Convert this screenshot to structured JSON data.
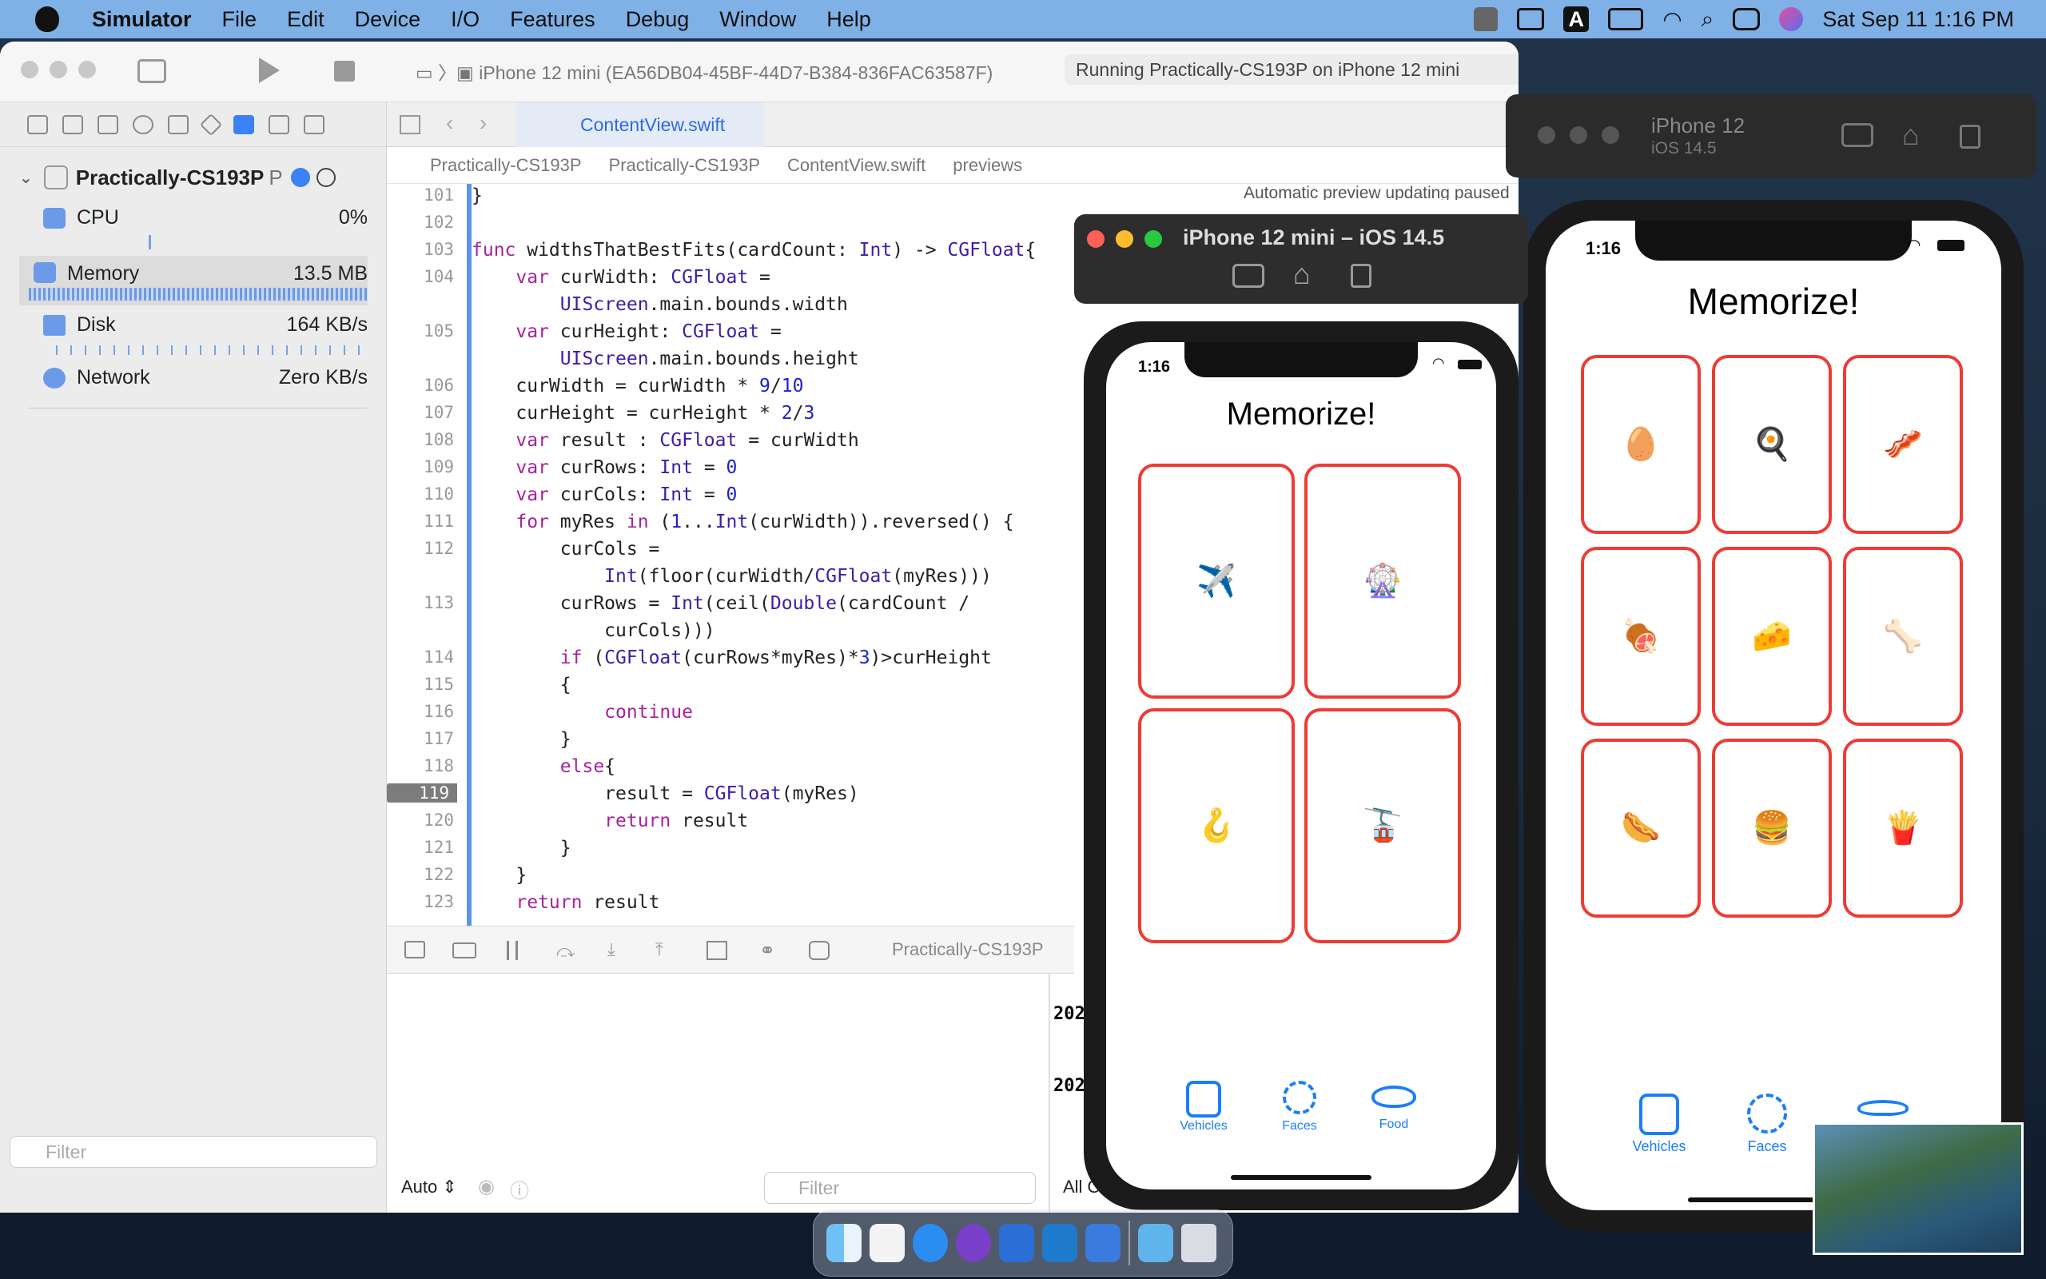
{
  "menubar": {
    "app": "Simulator",
    "items": [
      "File",
      "Edit",
      "Device",
      "I/O",
      "Features",
      "Debug",
      "Window",
      "Help"
    ],
    "clock": "Sat Sep 11  1:16 PM",
    "input_source": "A"
  },
  "xcode": {
    "scheme_device": "iPhone 12 mini (EA56DB04-45BF-44D7-B384-836FAC63587F)",
    "status": "Running Practically-CS193P on iPhone 12 mini",
    "tab": "ContentView.swift",
    "breadcrumb": [
      "Practically-CS193P",
      "Practically-CS193P",
      "ContentView.swift",
      "previews"
    ],
    "project": "Practically-CS193P",
    "project_suffix": "P",
    "gauges": [
      {
        "label": "CPU",
        "value": "0%"
      },
      {
        "label": "Memory",
        "value": "13.5 MB"
      },
      {
        "label": "Disk",
        "value": "164 KB/s"
      },
      {
        "label": "Network",
        "value": "Zero KB/s"
      }
    ],
    "nav_filter_placeholder": "Filter",
    "console_filter_placeholder": "Filter",
    "auto_label": "Auto",
    "all_output": "All Ou",
    "debug_target": "Practically-CS193P",
    "preview_notice": "Automatic preview updating paused",
    "console_lines": [
      "202",
      "202"
    ],
    "current_line": "119",
    "code": [
      {
        "n": "101",
        "t": "}"
      },
      {
        "n": "102",
        "t": ""
      },
      {
        "n": "103",
        "t": "func widthsThatBestFits(cardCount: Int) -> CGFloat{"
      },
      {
        "n": "104",
        "t": "    var curWidth: CGFloat ="
      },
      {
        "n": "",
        "t": "        UIScreen.main.bounds.width"
      },
      {
        "n": "105",
        "t": "    var curHeight: CGFloat ="
      },
      {
        "n": "",
        "t": "        UIScreen.main.bounds.height"
      },
      {
        "n": "106",
        "t": "    curWidth = curWidth * 9/10"
      },
      {
        "n": "107",
        "t": "    curHeight = curHeight * 2/3"
      },
      {
        "n": "108",
        "t": "    var result : CGFloat = curWidth"
      },
      {
        "n": "109",
        "t": "    var curRows: Int = 0"
      },
      {
        "n": "110",
        "t": "    var curCols: Int = 0"
      },
      {
        "n": "111",
        "t": "    for myRes in (1...Int(curWidth)).reversed() {"
      },
      {
        "n": "112",
        "t": "        curCols ="
      },
      {
        "n": "",
        "t": "            Int(floor(curWidth/CGFloat(myRes)))"
      },
      {
        "n": "113",
        "t": "        curRows = Int(ceil(Double(cardCount /"
      },
      {
        "n": "",
        "t": "            curCols)))"
      },
      {
        "n": "114",
        "t": "        if (CGFloat(curRows*myRes)*3)>curHeight"
      },
      {
        "n": "115",
        "t": "        {"
      },
      {
        "n": "116",
        "t": "            continue"
      },
      {
        "n": "117",
        "t": "        }"
      },
      {
        "n": "118",
        "t": "        else{"
      },
      {
        "n": "119",
        "t": "            result = CGFloat(myRes)"
      },
      {
        "n": "120",
        "t": "            return result"
      },
      {
        "n": "121",
        "t": "        }"
      },
      {
        "n": "122",
        "t": "    }"
      },
      {
        "n": "123",
        "t": "    return result"
      }
    ]
  },
  "sim_mini": {
    "window_title": "iPhone 12 mini – iOS 14.5",
    "time": "1:16",
    "app_title": "Memorize!",
    "cards": [
      "✈️",
      "🎡",
      "🪝",
      "🚡"
    ],
    "tabs": [
      "Vehicles",
      "Faces",
      "Food"
    ]
  },
  "sim_12": {
    "device": "iPhone 12",
    "os": "iOS 14.5",
    "time": "1:16",
    "app_title": "Memorize!",
    "cards": [
      "🥚",
      "🍳",
      "🥓",
      "🍖",
      "🧀",
      "🦴",
      "🌭",
      "🍔",
      "🍟"
    ],
    "tabs": [
      "Vehicles",
      "Faces"
    ]
  },
  "colors": {
    "card_border": "#ee3b35",
    "tint": "#1c7ef7",
    "menubar": "#7fb0e6"
  }
}
